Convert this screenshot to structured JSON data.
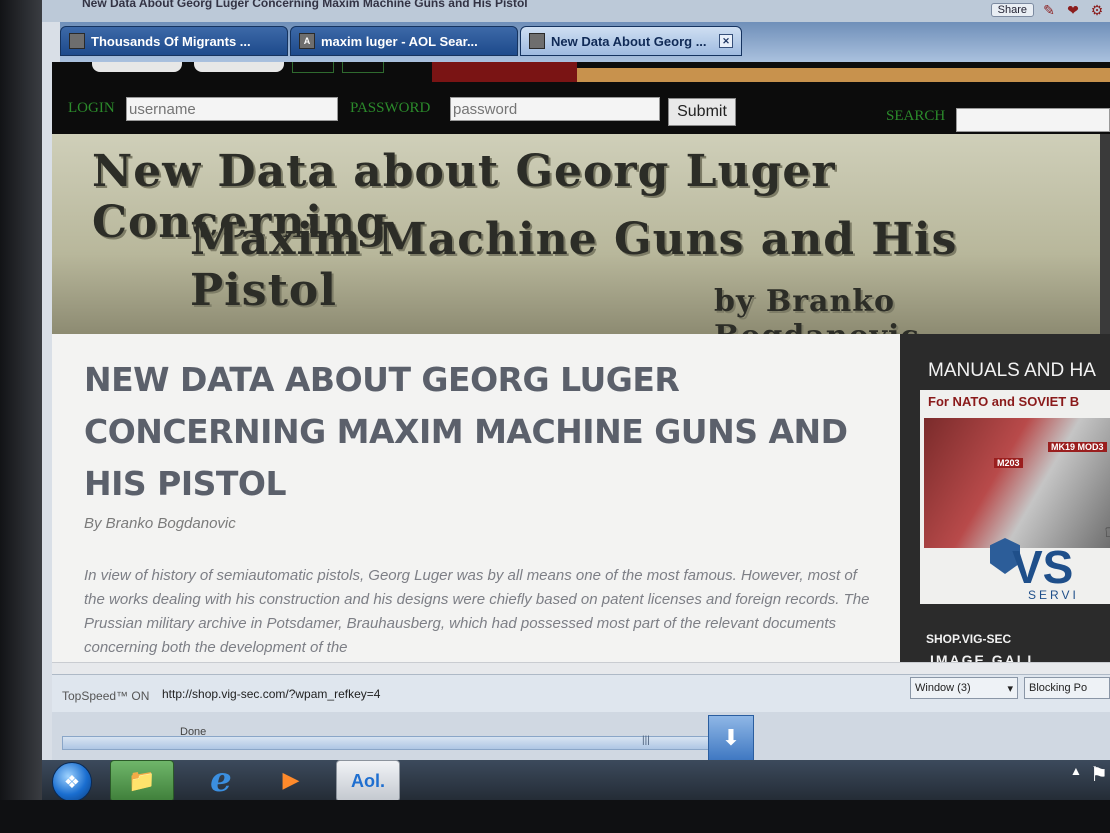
{
  "browser": {
    "title": "New Data About Georg Luger Concerning Maxim Machine Guns and His Pistol",
    "share_label": "Share",
    "tabs": [
      {
        "label": "Thousands Of Migrants ...",
        "favicon": "page-icon"
      },
      {
        "label": "maxim luger - AOL Sear...",
        "favicon": "aol-icon"
      },
      {
        "label": "New Data About Georg ...",
        "favicon": "page-icon",
        "active": true
      }
    ]
  },
  "site": {
    "login_label": "LOGIN",
    "username_placeholder": "username",
    "password_label": "PASSWORD",
    "password_placeholder": "password",
    "submit_label": "Submit",
    "search_label": "SEARCH",
    "banner": {
      "line1": "New Data about Georg Luger Concerning",
      "line2": "Maxim Machine Guns and His Pistol",
      "byline": "by Branko Bogdanovic"
    }
  },
  "article": {
    "headline_lines": [
      "NEW DATA ABOUT GEORG LUGER",
      "CONCERNING MAXIM MACHINE GUNS AND",
      "HIS PISTOL"
    ],
    "byline": "By Branko Bogdanovic",
    "body": "In view of history of semiautomatic pistols, Georg Luger was by all means one of the most famous. However, most of the works dealing with his construction and his designs were chiefly based on patent licenses and foreign records. The Prussian military archive in Potsdamer, Brauhausberg, which had possessed most part of the relevant documents concerning both the development of the"
  },
  "sidebar": {
    "ad_title": "MANUALS AND HA",
    "ad_subtitle": "For NATO and SOVIET B",
    "manual_caps": [
      "M203",
      "MK19 MOD3"
    ],
    "logo": "VS",
    "logo_sub": "SERVI",
    "shop": "SHOP.VIG-SEC",
    "gallery": "IMAGE GALL"
  },
  "statusbar": {
    "topspeed": "TopSpeed™ ON",
    "url": "http://shop.vig-sec.com/?wpam_refkey=4",
    "window_btn": "Window (3)",
    "blocking": "Blocking Po",
    "done": "Done"
  },
  "taskbar": {
    "aol_label": "Aol."
  }
}
